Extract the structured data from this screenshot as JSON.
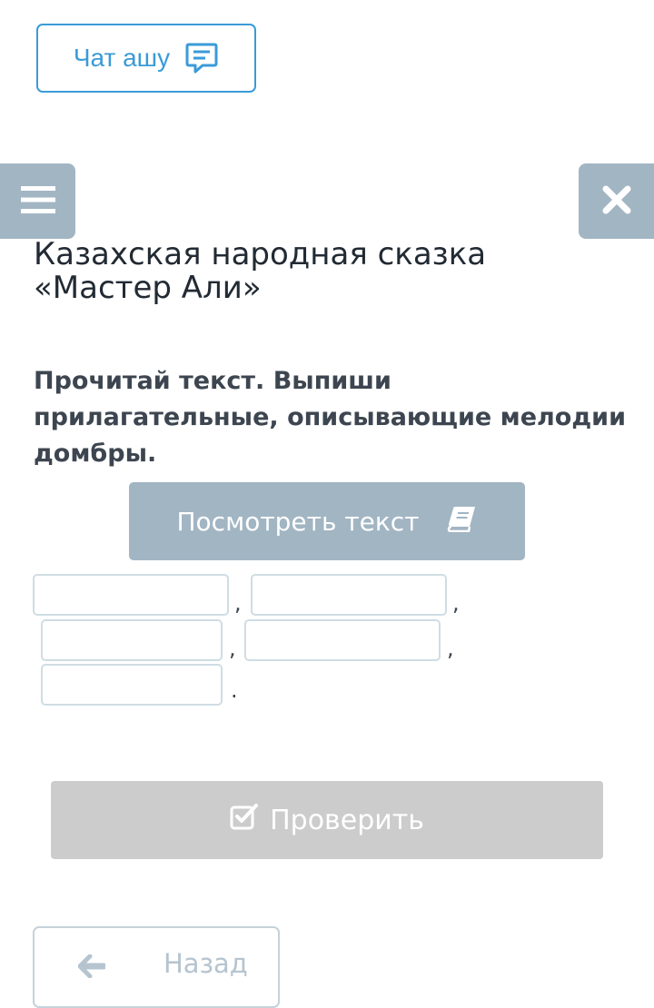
{
  "chat": {
    "label": "Чат ашу",
    "icon": "chat-bubble-icon"
  },
  "menu": {
    "icon": "hamburger-menu-icon"
  },
  "close": {
    "icon": "close-icon"
  },
  "lesson": {
    "title": "Казахская народная сказка «Мастер Али»"
  },
  "task": {
    "instruction": "Прочитай текст. Выпиши прилагательные, описывающие мелодии домбры.",
    "view_text_label": "Посмотреть текст",
    "view_text_icon": "book-icon"
  },
  "answers": {
    "fields": [
      {
        "value": "",
        "placeholder": ""
      },
      {
        "value": "",
        "placeholder": ""
      },
      {
        "value": "",
        "placeholder": ""
      },
      {
        "value": "",
        "placeholder": ""
      },
      {
        "value": "",
        "placeholder": ""
      }
    ],
    "separators": [
      ",",
      ",",
      ",",
      ",",
      "."
    ]
  },
  "check": {
    "label": "Проверить",
    "icon": "checkbox-icon"
  },
  "back": {
    "label": "Назад",
    "icon": "arrow-left-icon"
  },
  "colors": {
    "accent": "#3a9bd8",
    "panel_button": "#a2b5c3",
    "disabled_button": "#cccccc",
    "input_border": "#cfdde4"
  }
}
